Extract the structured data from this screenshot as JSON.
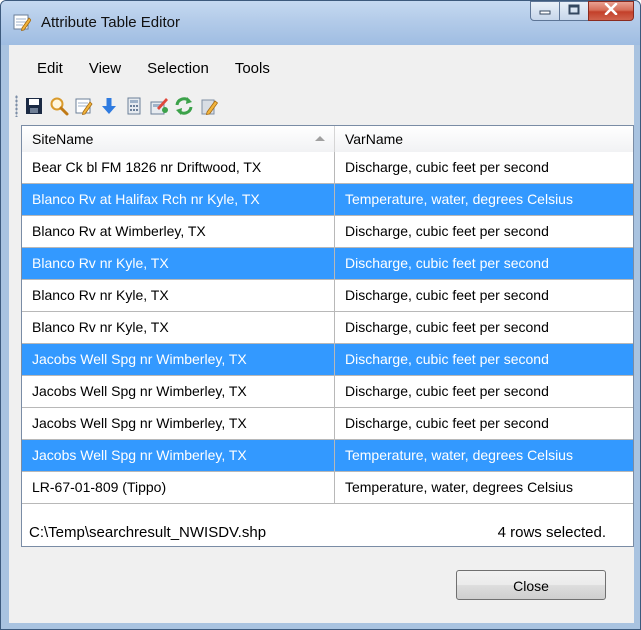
{
  "window": {
    "title": "Attribute Table Editor",
    "caption_buttons": [
      "minimize",
      "maximize",
      "close"
    ]
  },
  "menubar": {
    "items": [
      {
        "label": "Edit"
      },
      {
        "label": "View"
      },
      {
        "label": "Selection"
      },
      {
        "label": "Tools"
      }
    ]
  },
  "toolbar": {
    "buttons": [
      {
        "icon": "save-icon"
      },
      {
        "icon": "magnifier-icon"
      },
      {
        "icon": "edit-table-icon"
      },
      {
        "icon": "down-arrow-icon"
      },
      {
        "icon": "calculator-icon"
      },
      {
        "icon": "field-calculator-icon"
      },
      {
        "icon": "refresh-icon"
      },
      {
        "icon": "clear-selection-icon"
      }
    ]
  },
  "grid": {
    "columns": [
      {
        "label": "SiteName",
        "sorted": "ascending"
      },
      {
        "label": "VarName"
      }
    ],
    "rows": [
      {
        "site": "Bear Ck bl FM 1826 nr Driftwood, TX",
        "var": "Discharge, cubic feet per second",
        "selected": false
      },
      {
        "site": "Blanco Rv at Halifax Rch nr Kyle, TX",
        "var": "Temperature, water, degrees Celsius",
        "selected": true
      },
      {
        "site": "Blanco Rv at Wimberley, TX",
        "var": "Discharge, cubic feet per second",
        "selected": false
      },
      {
        "site": "Blanco Rv nr Kyle, TX",
        "var": "Discharge, cubic feet per second",
        "selected": true
      },
      {
        "site": "Blanco Rv nr Kyle, TX",
        "var": "Discharge, cubic feet per second",
        "selected": false
      },
      {
        "site": "Blanco Rv nr Kyle, TX",
        "var": "Discharge, cubic feet per second",
        "selected": false
      },
      {
        "site": "Jacobs Well Spg nr Wimberley, TX",
        "var": "Discharge, cubic feet per second",
        "selected": true
      },
      {
        "site": "Jacobs Well Spg nr Wimberley, TX",
        "var": "Discharge, cubic feet per second",
        "selected": false
      },
      {
        "site": "Jacobs Well Spg nr Wimberley, TX",
        "var": "Discharge, cubic feet per second",
        "selected": false
      },
      {
        "site": "Jacobs Well Spg nr Wimberley, TX",
        "var": "Temperature, water, degrees Celsius",
        "selected": true
      },
      {
        "site": "LR-67-01-809 (Tippo)",
        "var": "Temperature, water, degrees Celsius",
        "selected": false
      }
    ]
  },
  "status": {
    "file_path": "C:\\Temp\\searchresult_NWISDV.shp",
    "selection_count": "4 rows selected."
  },
  "buttons": {
    "close_label": "Close"
  },
  "colors": {
    "selection": "#3399ff",
    "titlebar": "#b9d1ea",
    "close_caption": "#c7432d"
  }
}
